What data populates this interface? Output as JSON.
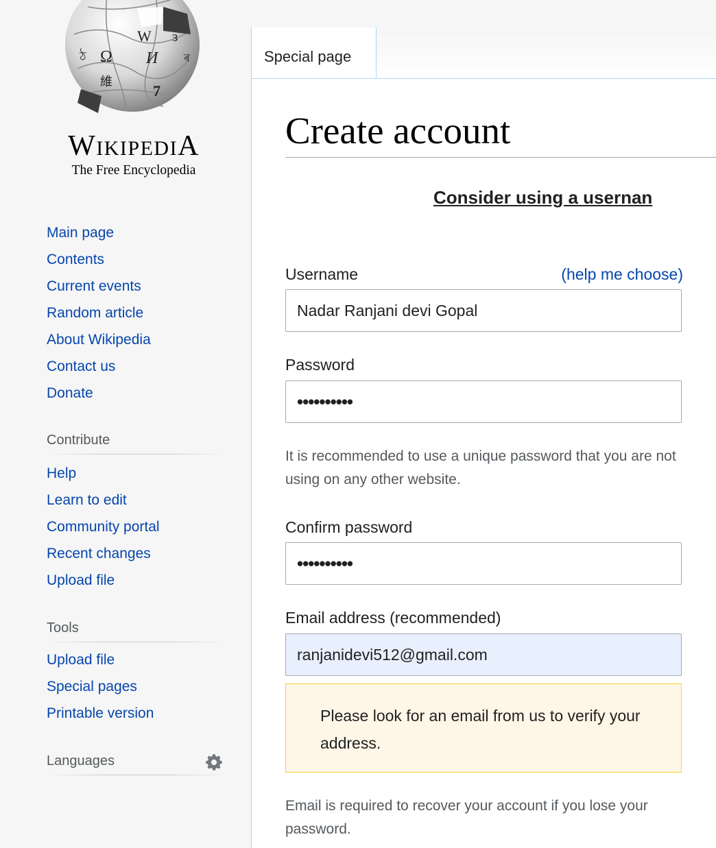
{
  "logo": {
    "wordmark_first": "W",
    "wordmark_rest": "IKIPEDI",
    "wordmark_last": "A",
    "tagline": "The Free Encyclopedia"
  },
  "sidebar": {
    "navigation": [
      "Main page",
      "Contents",
      "Current events",
      "Random article",
      "About Wikipedia",
      "Contact us",
      "Donate"
    ],
    "contribute": {
      "heading": "Contribute",
      "items": [
        "Help",
        "Learn to edit",
        "Community portal",
        "Recent changes",
        "Upload file"
      ]
    },
    "tools": {
      "heading": "Tools",
      "items": [
        "Upload file",
        "Special pages",
        "Printable version"
      ]
    },
    "languages": {
      "heading": "Languages",
      "icon": "gear-icon"
    }
  },
  "tabs": {
    "special_page": "Special page"
  },
  "page": {
    "title": "Create account",
    "notice_link": "Consider using a usernan"
  },
  "form": {
    "username_label": "Username",
    "help_choose_link": "(help me choose)",
    "username_value": "Nadar Ranjani devi Gopal",
    "password_label": "Password",
    "password_value": "••••••••••",
    "password_help": "It is recommended to use a unique password that you are not using on any other website.",
    "confirm_label": "Confirm password",
    "confirm_value": "••••••••••",
    "email_label": "Email address (recommended)",
    "email_value": "ranjanidevi512@gmail.com",
    "email_warning": "Please look for an email from us to verify your address.",
    "email_help": "Email is required to recover your account if you lose your password."
  },
  "colors": {
    "link": "#0645ad",
    "sidebar_bg": "#f6f6f6",
    "warning_bg": "#fef6e7",
    "warning_border": "#ffcc33",
    "autofill_bg": "#e8f0fe"
  }
}
